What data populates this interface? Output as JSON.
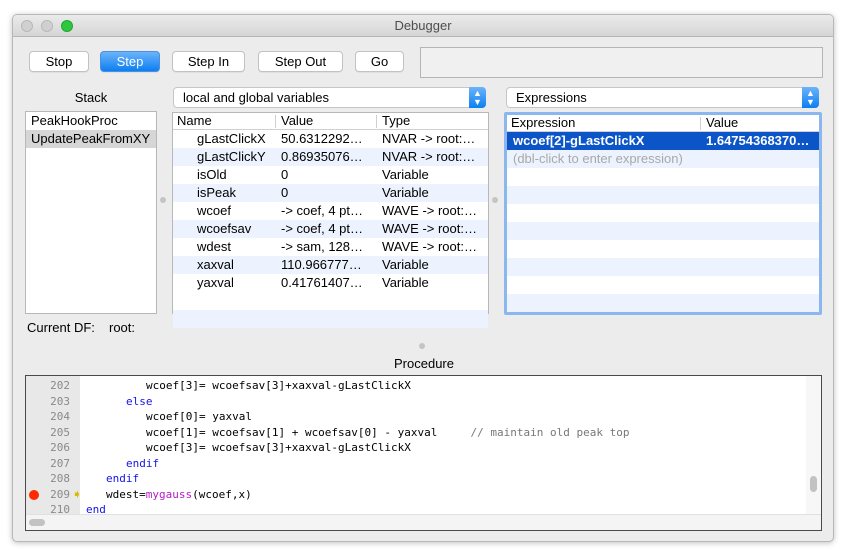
{
  "window": {
    "title": "Debugger"
  },
  "toolbar": {
    "stop": "Stop",
    "step": "Step",
    "step_in": "Step In",
    "step_out": "Step Out",
    "go": "Go"
  },
  "stack": {
    "label": "Stack",
    "items": [
      "PeakHookProc",
      "UpdatePeakFromXY"
    ],
    "selected": "UpdatePeakFromXY"
  },
  "variables": {
    "popup": "local and global variables",
    "columns": [
      "Name",
      "Value",
      "Type"
    ],
    "rows": [
      [
        "gLastClickX",
        "50.6312292…",
        "NVAR -> root:…"
      ],
      [
        "gLastClickY",
        "0.86935076…",
        "NVAR -> root:…"
      ],
      [
        "isOld",
        "0",
        "Variable"
      ],
      [
        "isPeak",
        "0",
        "Variable"
      ],
      [
        "wcoef",
        "-> coef, 4 pt…",
        "WAVE -> root:…"
      ],
      [
        "wcoefsav",
        "-> coef, 4 pt…",
        "WAVE -> root:…"
      ],
      [
        "wdest",
        "-> sam, 128…",
        "WAVE -> root:…"
      ],
      [
        "xaxval",
        "110.966777…",
        "Variable"
      ],
      [
        "yaxval",
        "0.41761407…",
        "Variable"
      ]
    ]
  },
  "expressions": {
    "popup": "Expressions",
    "columns": [
      "Expression",
      "Value"
    ],
    "rows": [
      [
        "wcoef[2]-gLastClickX",
        "1.64754368370…"
      ]
    ],
    "placeholder": "(dbl-click to enter expression)"
  },
  "current_df": {
    "label": "Current DF:",
    "value": "root:"
  },
  "procedure": {
    "label": "Procedure",
    "breakpoint_line": "209",
    "current_line": "209",
    "lines": [
      {
        "n": "202",
        "indent": 3,
        "tokens": [
          [
            "",
            "wcoef[3]= wcoefsav[3]+xaxval-gLastClickX"
          ]
        ]
      },
      {
        "n": "203",
        "indent": 2,
        "tokens": [
          [
            "kw",
            "else"
          ]
        ]
      },
      {
        "n": "204",
        "indent": 3,
        "tokens": [
          [
            "",
            "wcoef[0]= yaxval"
          ]
        ]
      },
      {
        "n": "205",
        "indent": 3,
        "tokens": [
          [
            "",
            "wcoef[1]= wcoefsav[1] + wcoefsav[0] - yaxval     "
          ],
          [
            "cm",
            "// maintain old peak top"
          ]
        ]
      },
      {
        "n": "206",
        "indent": 3,
        "tokens": [
          [
            "",
            "wcoef[3]= wcoefsav[3]+xaxval-gLastClickX"
          ]
        ]
      },
      {
        "n": "207",
        "indent": 2,
        "tokens": [
          [
            "kw",
            "endif"
          ]
        ]
      },
      {
        "n": "208",
        "indent": 1,
        "tokens": [
          [
            "kw",
            "endif"
          ]
        ]
      },
      {
        "n": "209",
        "indent": 1,
        "tokens": [
          [
            "",
            "wdest="
          ],
          [
            "fn",
            "mygauss"
          ],
          [
            "",
            "(wcoef,x)"
          ]
        ]
      },
      {
        "n": "210",
        "indent": 0,
        "tokens": [
          [
            "kw",
            "end"
          ]
        ]
      }
    ]
  },
  "colors": {
    "accent": "#0c7ff2",
    "selection": "#0b55c8",
    "breakpoint": "#ff2a00",
    "keyword": "#1414e6",
    "function": "#b01ec4",
    "comment": "#777777"
  }
}
